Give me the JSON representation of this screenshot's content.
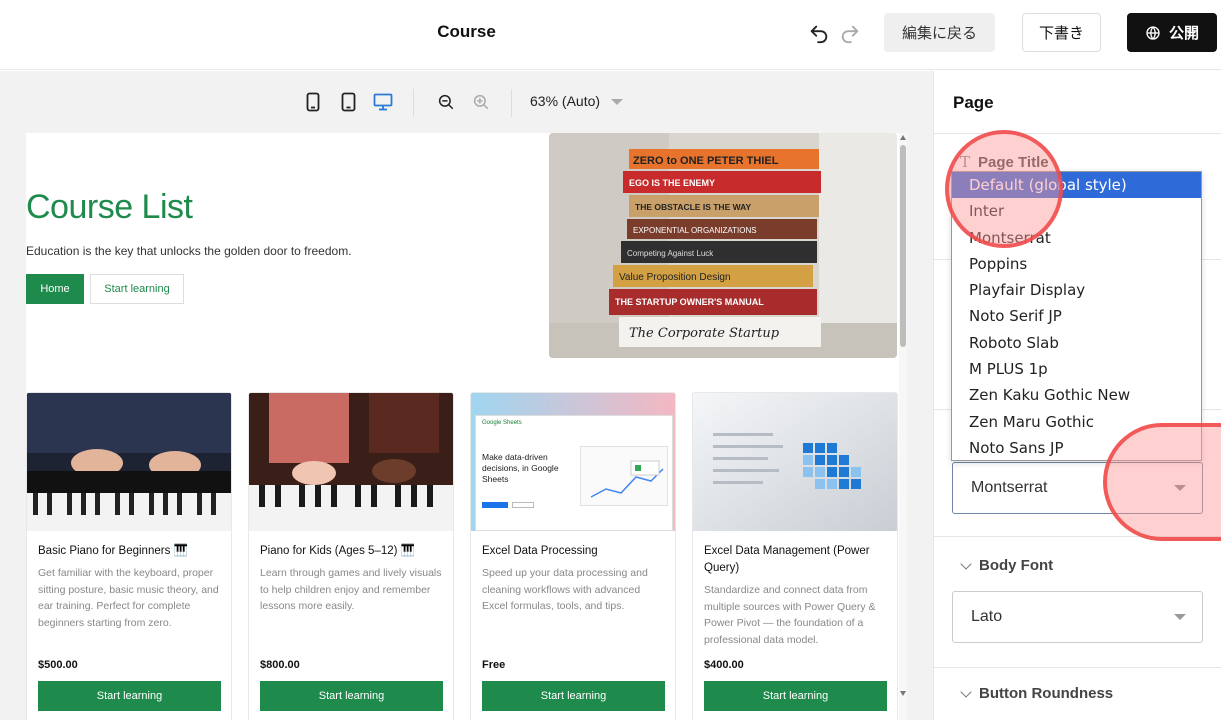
{
  "header": {
    "title": "Course",
    "back_label": "編集に戻る",
    "draft_label": "下書き",
    "publish_label": "公開"
  },
  "zoom": {
    "label": "63% (Auto)"
  },
  "hero": {
    "title": "Course List",
    "subtitle": "Education is the key that unlocks the golden door to freedom.",
    "home_label": "Home",
    "start_label": "Start learning"
  },
  "courses": [
    {
      "title": "Basic Piano for Beginners 🎹",
      "desc": "Get familiar with the keyboard, proper sitting posture, basic music theory, and ear training. Perfect for complete beginners starting from zero.",
      "price": "$500.00",
      "button": "Start learning"
    },
    {
      "title": "Piano for Kids (Ages 5–12) 🎹",
      "desc": "Learn through games and lively visuals to help children enjoy and remember lessons more easily.",
      "price": "$800.00",
      "button": "Start learning"
    },
    {
      "title": "Excel Data Processing",
      "desc": "Speed up your data processing and cleaning workflows with advanced Excel formulas, tools, and tips.",
      "price": "Free",
      "button": "Start learning"
    },
    {
      "title": "Excel Data Management (Power Query)",
      "desc": "Standardize and connect data from multiple sources with Power Query & Power Pivot — the foundation of a professional data model.",
      "price": "$400.00",
      "button": "Start learning"
    }
  ],
  "excel_card": {
    "brand": "Google Sheets",
    "headline": "Make data-driven decisions, in Google Sheets"
  },
  "books": [
    "ZERO to ONE  PETER THIEL",
    "EGO IS THE ENEMY",
    "THE OBSTACLE IS THE WAY",
    "EXPONENTIAL ORGANIZATIONS",
    "Competing Against Luck",
    "Value Proposition Design",
    "THE STARTUP OWNER'S MANUAL",
    "The Corporate Startup"
  ],
  "panel": {
    "title": "Page",
    "page_title_label": "Page Title",
    "page_title_font": "Montserrat",
    "body_font_label": "Body Font",
    "body_font": "Lato",
    "button_roundness_label": "Button Roundness",
    "font_options": [
      "Default (global style)",
      "Inter",
      "Montserrat",
      "Poppins",
      "Playfair Display",
      "Noto Serif JP",
      "Roboto Slab",
      "M PLUS 1p",
      "Zen Kaku Gothic New",
      "Zen Maru Gothic",
      "Noto Sans JP"
    ]
  },
  "colors": {
    "accent_green": "#1e8a4c",
    "selection_blue": "#2f6bd8",
    "annotation_red": "#f04646"
  }
}
